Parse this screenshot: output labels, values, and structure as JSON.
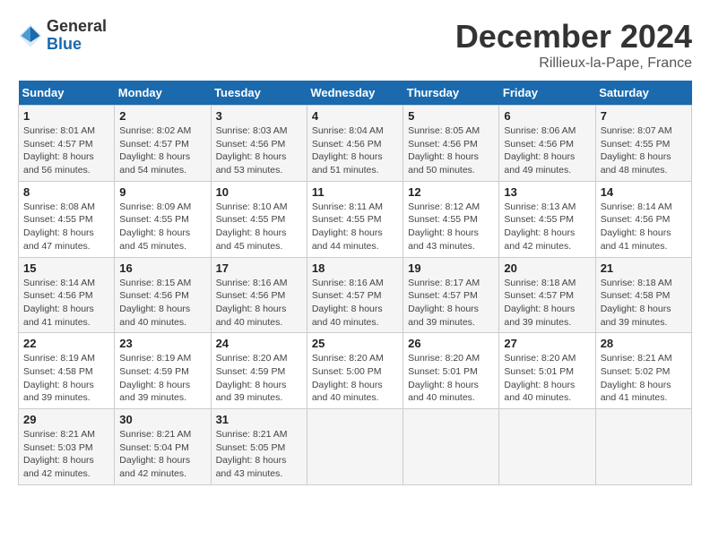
{
  "header": {
    "logo": {
      "general": "General",
      "blue": "Blue"
    },
    "title": "December 2024",
    "location": "Rillieux-la-Pape, France"
  },
  "calendar": {
    "days_of_week": [
      "Sunday",
      "Monday",
      "Tuesday",
      "Wednesday",
      "Thursday",
      "Friday",
      "Saturday"
    ],
    "weeks": [
      [
        null,
        null,
        {
          "day": 1,
          "sunrise": "8:01 AM",
          "sunset": "4:57 PM",
          "daylight": "8 hours and 56 minutes"
        },
        {
          "day": 2,
          "sunrise": "8:02 AM",
          "sunset": "4:57 PM",
          "daylight": "8 hours and 54 minutes"
        },
        {
          "day": 3,
          "sunrise": "8:03 AM",
          "sunset": "4:56 PM",
          "daylight": "8 hours and 53 minutes"
        },
        {
          "day": 4,
          "sunrise": "8:04 AM",
          "sunset": "4:56 PM",
          "daylight": "8 hours and 51 minutes"
        },
        {
          "day": 5,
          "sunrise": "8:05 AM",
          "sunset": "4:56 PM",
          "daylight": "8 hours and 50 minutes"
        },
        {
          "day": 6,
          "sunrise": "8:06 AM",
          "sunset": "4:56 PM",
          "daylight": "8 hours and 49 minutes"
        },
        {
          "day": 7,
          "sunrise": "8:07 AM",
          "sunset": "4:55 PM",
          "daylight": "8 hours and 48 minutes"
        }
      ],
      [
        {
          "day": 8,
          "sunrise": "8:08 AM",
          "sunset": "4:55 PM",
          "daylight": "8 hours and 47 minutes"
        },
        {
          "day": 9,
          "sunrise": "8:09 AM",
          "sunset": "4:55 PM",
          "daylight": "8 hours and 45 minutes"
        },
        {
          "day": 10,
          "sunrise": "8:10 AM",
          "sunset": "4:55 PM",
          "daylight": "8 hours and 45 minutes"
        },
        {
          "day": 11,
          "sunrise": "8:11 AM",
          "sunset": "4:55 PM",
          "daylight": "8 hours and 44 minutes"
        },
        {
          "day": 12,
          "sunrise": "8:12 AM",
          "sunset": "4:55 PM",
          "daylight": "8 hours and 43 minutes"
        },
        {
          "day": 13,
          "sunrise": "8:13 AM",
          "sunset": "4:55 PM",
          "daylight": "8 hours and 42 minutes"
        },
        {
          "day": 14,
          "sunrise": "8:14 AM",
          "sunset": "4:56 PM",
          "daylight": "8 hours and 41 minutes"
        }
      ],
      [
        {
          "day": 15,
          "sunrise": "8:14 AM",
          "sunset": "4:56 PM",
          "daylight": "8 hours and 41 minutes"
        },
        {
          "day": 16,
          "sunrise": "8:15 AM",
          "sunset": "4:56 PM",
          "daylight": "8 hours and 40 minutes"
        },
        {
          "day": 17,
          "sunrise": "8:16 AM",
          "sunset": "4:56 PM",
          "daylight": "8 hours and 40 minutes"
        },
        {
          "day": 18,
          "sunrise": "8:16 AM",
          "sunset": "4:57 PM",
          "daylight": "8 hours and 40 minutes"
        },
        {
          "day": 19,
          "sunrise": "8:17 AM",
          "sunset": "4:57 PM",
          "daylight": "8 hours and 39 minutes"
        },
        {
          "day": 20,
          "sunrise": "8:18 AM",
          "sunset": "4:57 PM",
          "daylight": "8 hours and 39 minutes"
        },
        {
          "day": 21,
          "sunrise": "8:18 AM",
          "sunset": "4:58 PM",
          "daylight": "8 hours and 39 minutes"
        }
      ],
      [
        {
          "day": 22,
          "sunrise": "8:19 AM",
          "sunset": "4:58 PM",
          "daylight": "8 hours and 39 minutes"
        },
        {
          "day": 23,
          "sunrise": "8:19 AM",
          "sunset": "4:59 PM",
          "daylight": "8 hours and 39 minutes"
        },
        {
          "day": 24,
          "sunrise": "8:20 AM",
          "sunset": "4:59 PM",
          "daylight": "8 hours and 39 minutes"
        },
        {
          "day": 25,
          "sunrise": "8:20 AM",
          "sunset": "5:00 PM",
          "daylight": "8 hours and 40 minutes"
        },
        {
          "day": 26,
          "sunrise": "8:20 AM",
          "sunset": "5:01 PM",
          "daylight": "8 hours and 40 minutes"
        },
        {
          "day": 27,
          "sunrise": "8:20 AM",
          "sunset": "5:01 PM",
          "daylight": "8 hours and 40 minutes"
        },
        {
          "day": 28,
          "sunrise": "8:21 AM",
          "sunset": "5:02 PM",
          "daylight": "8 hours and 41 minutes"
        }
      ],
      [
        {
          "day": 29,
          "sunrise": "8:21 AM",
          "sunset": "5:03 PM",
          "daylight": "8 hours and 42 minutes"
        },
        {
          "day": 30,
          "sunrise": "8:21 AM",
          "sunset": "5:04 PM",
          "daylight": "8 hours and 42 minutes"
        },
        {
          "day": 31,
          "sunrise": "8:21 AM",
          "sunset": "5:05 PM",
          "daylight": "8 hours and 43 minutes"
        },
        null,
        null,
        null,
        null
      ]
    ]
  }
}
